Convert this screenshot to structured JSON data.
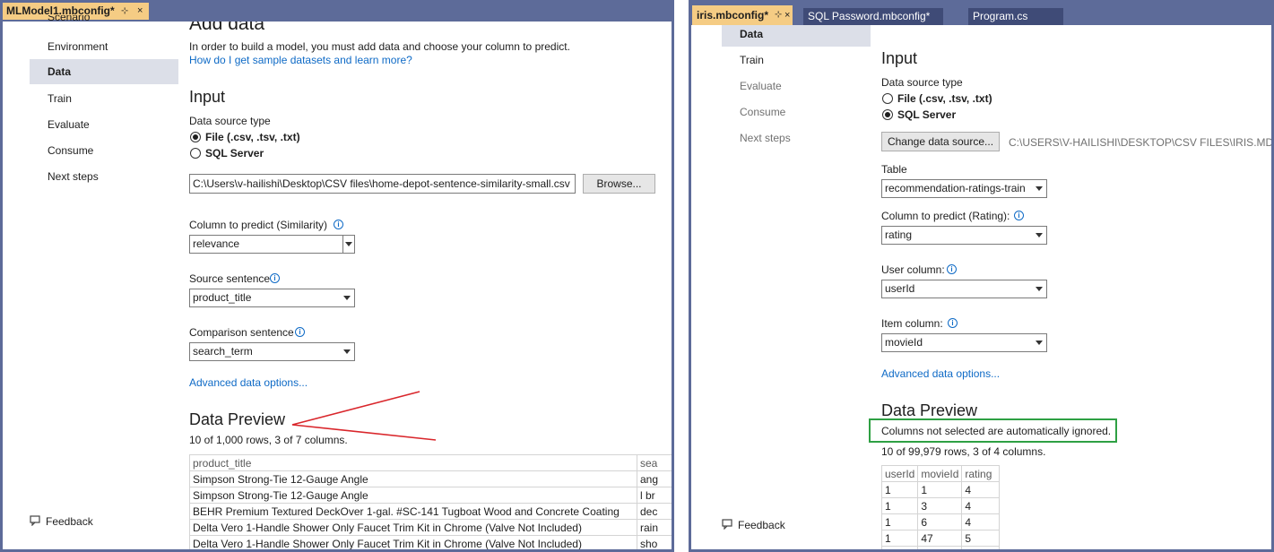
{
  "left": {
    "tabs": [
      {
        "label": "MLModel1.mbconfig*",
        "pin": "⊹",
        "close": "×"
      }
    ],
    "nav": [
      "Scenario",
      "Environment",
      "Data",
      "Train",
      "Evaluate",
      "Consume",
      "Next steps"
    ],
    "feedback": "Feedback",
    "page_title": "Add data",
    "intro": "In order to build a model, you must add data and choose your column to predict.",
    "sample_link": "How do I get sample datasets and learn more?",
    "input_title": "Input",
    "datasource_label": "Data source type",
    "option_file": "File (.csv, .tsv, .txt)",
    "option_sql": "SQL Server",
    "file_path": "C:\\Users\\v-hailishi\\Desktop\\CSV files\\home-depot-sentence-similarity-small.csv",
    "browse": "Browse...",
    "col_predict_label": "Column to predict (Similarity)",
    "col_predict_value": "relevance",
    "source_label": "Source sentence",
    "source_value": "product_title",
    "comparison_label": "Comparison sentence",
    "comparison_value": "search_term",
    "advanced": "Advanced data options...",
    "preview_title": "Data Preview",
    "preview_count": "10 of 1,000 rows, 3 of 7 columns.",
    "table": {
      "headers": [
        "product_title",
        "sea"
      ],
      "rows": [
        [
          "Simpson Strong-Tie 12-Gauge Angle",
          "ang"
        ],
        [
          "Simpson Strong-Tie 12-Gauge Angle",
          "l br"
        ],
        [
          "BEHR Premium Textured DeckOver 1-gal. #SC-141 Tugboat Wood and Concrete Coating",
          "dec"
        ],
        [
          "Delta Vero 1-Handle Shower Only Faucet Trim Kit in Chrome (Valve Not Included)",
          "rain"
        ],
        [
          "Delta Vero 1-Handle Shower Only Faucet Trim Kit in Chrome (Valve Not Included)",
          "sho"
        ]
      ]
    },
    "annotation_color": "#d9262b"
  },
  "right": {
    "tabs": [
      {
        "label": "iris.mbconfig*",
        "pin": "⊹",
        "close": "×"
      },
      {
        "label": "SQL Password.mbconfig*"
      },
      {
        "label": "Program.cs"
      }
    ],
    "nav": [
      "Data",
      "Train",
      "Evaluate",
      "Consume",
      "Next steps"
    ],
    "feedback": "Feedback",
    "input_title": "Input",
    "datasource_label": "Data source type",
    "option_file": "File (.csv, .tsv, .txt)",
    "option_sql": "SQL Server",
    "change_source": "Change data source...",
    "source_path": "C:\\USERS\\V-HAILISHI\\DESKTOP\\CSV FILES\\IRIS.MDF",
    "table_label": "Table",
    "table_value": "recommendation-ratings-train",
    "col_predict_label": "Column to predict (Rating):",
    "col_predict_value": "rating",
    "user_label": "User column:",
    "user_value": "userId",
    "item_label": "Item column:",
    "item_value": "movieId",
    "advanced": "Advanced data options...",
    "preview_title": "Data Preview",
    "ignored_note": "Columns not selected are automatically ignored.",
    "preview_count": "10 of 99,979 rows, 3 of 4 columns.",
    "table": {
      "headers": [
        "userId",
        "movieId",
        "rating"
      ],
      "rows": [
        [
          "1",
          "1",
          "4"
        ],
        [
          "1",
          "3",
          "4"
        ],
        [
          "1",
          "6",
          "4"
        ],
        [
          "1",
          "47",
          "5"
        ]
      ]
    },
    "highlight_color": "#2ea043"
  },
  "colors": {
    "frame": "#5d6b99",
    "active_tab": "#f5cc84",
    "link": "#0e6ac6",
    "selected_nav": "#dcdfe8"
  }
}
